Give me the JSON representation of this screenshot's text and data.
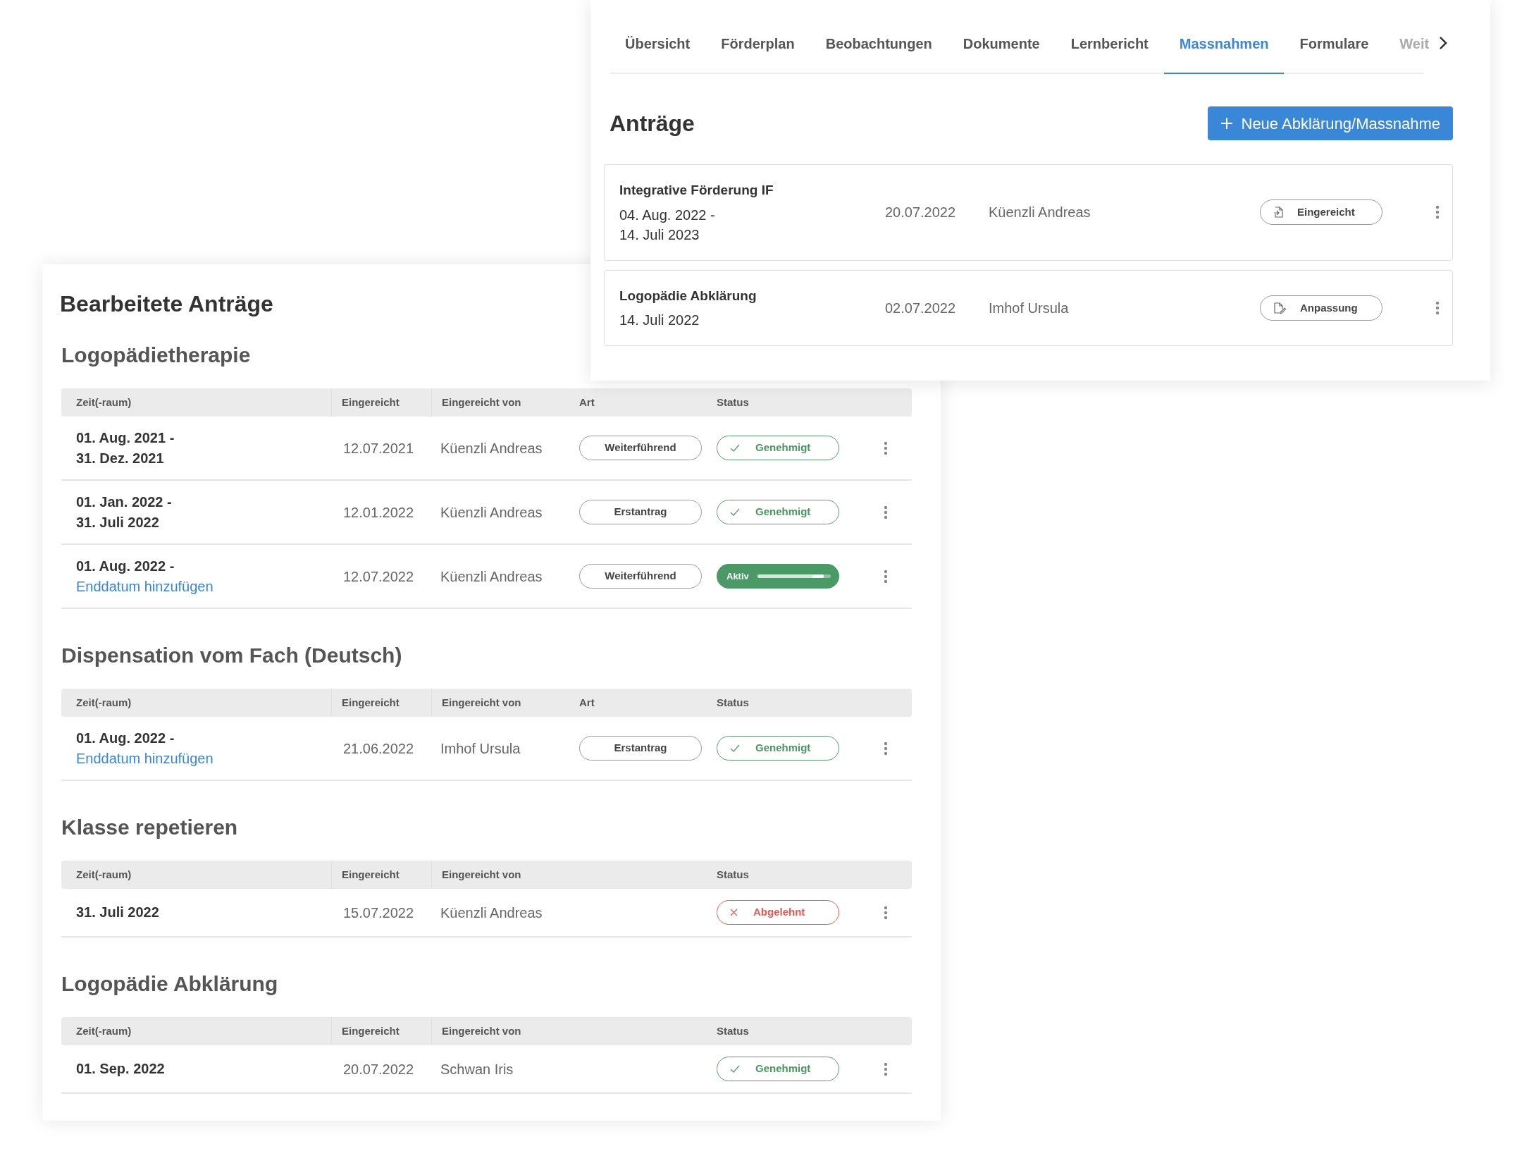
{
  "tabs": [
    {
      "label": "Übersicht",
      "selected": false
    },
    {
      "label": "Förderplan",
      "selected": false
    },
    {
      "label": "Beobachtungen",
      "selected": false
    },
    {
      "label": "Dokumente",
      "selected": false
    },
    {
      "label": "Lernbericht",
      "selected": false
    },
    {
      "label": "Massnahmen",
      "selected": true
    },
    {
      "label": "Formulare",
      "selected": false
    },
    {
      "label": "Weit",
      "selected": false
    }
  ],
  "applications": {
    "title": "Anträge",
    "new_button": "Neue Abklärung/Massnahme",
    "items": [
      {
        "title": "Integrative Förderung IF",
        "period": [
          "04. Aug. 2022 -",
          "14. Juli 2023"
        ],
        "submitted": "20.07.2022",
        "by": "Küenzli Andreas",
        "status": {
          "kind": "submitted",
          "label": "Eingereicht"
        }
      },
      {
        "title": "Logopädie Abklärung",
        "period": [
          "14. Juli 2022"
        ],
        "submitted": "02.07.2022",
        "by": "Imhof Ursula",
        "status": {
          "kind": "adjustment",
          "label": "Anpassung"
        }
      }
    ]
  },
  "processed": {
    "title": "Bearbeitete Anträge",
    "sections": [
      {
        "title": "Logopädietherapie",
        "columns": [
          "Zeit(-raum)",
          "Eingereicht",
          "Eingereicht von",
          "Art",
          "Status"
        ],
        "rows": [
          {
            "period": [
              "01. Aug. 2021 -",
              "31. Dez. 2021"
            ],
            "submitted": "12.07.2021",
            "by": "Küenzli Andreas",
            "type": "Weiterführend",
            "status": {
              "kind": "approved",
              "label": "Genehmigt"
            }
          },
          {
            "period": [
              "01. Jan. 2022 -",
              "31. Juli 2022"
            ],
            "submitted": "12.01.2022",
            "by": "Küenzli Andreas",
            "type": "Erstantrag",
            "status": {
              "kind": "approved",
              "label": "Genehmigt"
            }
          },
          {
            "period": [
              "01. Aug. 2022 -"
            ],
            "add_end_link": "Enddatum hinzufügen",
            "submitted": "12.07.2022",
            "by": "Küenzli Andreas",
            "type": "Weiterführend",
            "status": {
              "kind": "active",
              "label": "Aktiv",
              "level": 0.9
            }
          }
        ]
      },
      {
        "title": "Dispensation vom Fach (Deutsch)",
        "columns": [
          "Zeit(-raum)",
          "Eingereicht",
          "Eingereicht von",
          "Art",
          "Status"
        ],
        "rows": [
          {
            "period": [
              "01. Aug. 2022 -"
            ],
            "add_end_link": "Enddatum hinzufügen",
            "submitted": "21.06.2022",
            "by": "Imhof Ursula",
            "type": "Erstantrag",
            "status": {
              "kind": "approved",
              "label": "Genehmigt"
            }
          }
        ]
      },
      {
        "title": "Klasse repetieren",
        "columns": [
          "Zeit(-raum)",
          "Eingereicht",
          "Eingereicht von",
          "Status"
        ],
        "rows": [
          {
            "period": [
              "31. Juli 2022"
            ],
            "submitted": "15.07.2022",
            "by": "Küenzli Andreas",
            "status": {
              "kind": "rejected",
              "label": "Abgelehnt"
            }
          }
        ]
      },
      {
        "title": "Logopädie Abklärung",
        "columns": [
          "Zeit(-raum)",
          "Eingereicht",
          "Eingereicht von",
          "Status"
        ],
        "rows": [
          {
            "period": [
              "01. Sep. 2022"
            ],
            "submitted": "20.07.2022",
            "by": "Schwan Iris",
            "status": {
              "kind": "approved",
              "label": "Genehmigt"
            }
          }
        ]
      }
    ]
  }
}
